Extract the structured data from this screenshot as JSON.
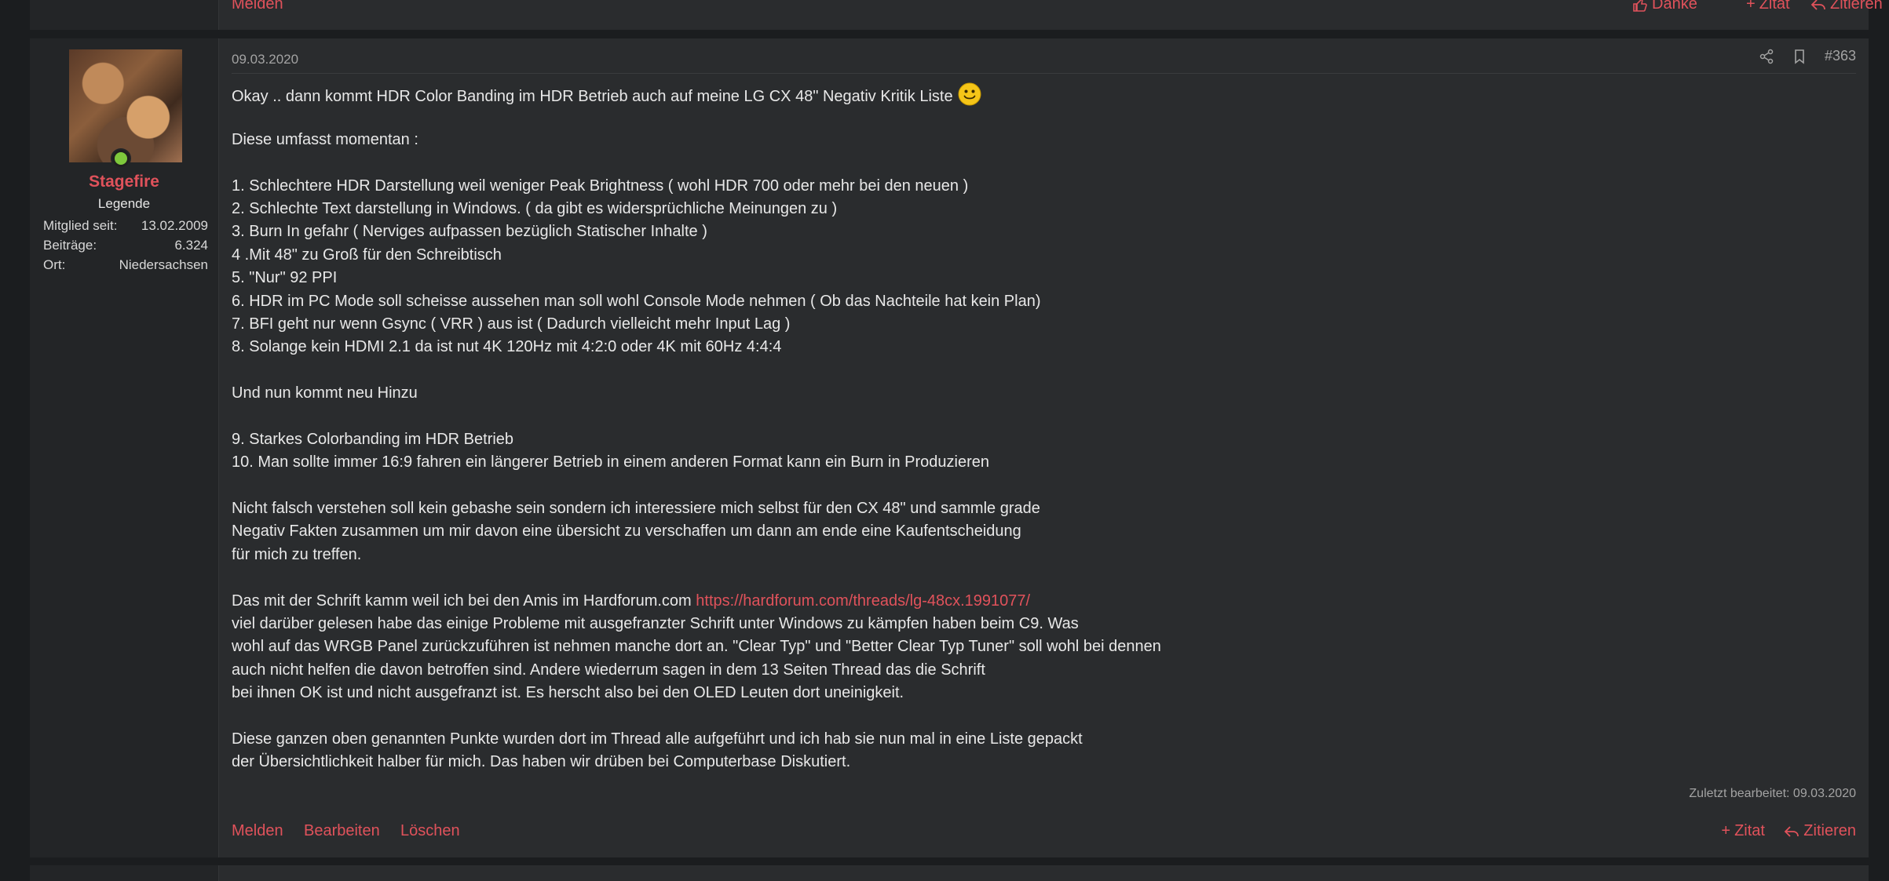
{
  "prev_post": {
    "actions": {
      "report": "Melden",
      "thanks": "Danke",
      "quote": "Zitat",
      "reply": "Zitieren"
    }
  },
  "user": {
    "name": "Stagefire",
    "rank": "Legende",
    "member_since_label": "Mitglied seit:",
    "member_since": "13.02.2009",
    "posts_label": "Beiträge:",
    "posts": "6.324",
    "location_label": "Ort:",
    "location": "Niedersachsen"
  },
  "post": {
    "date": "09.03.2020",
    "number": "#363",
    "first_line": "Okay .. dann kommt HDR Color Banding im HDR Betrieb auch auf meine LG CX 48\" Negativ Kritik Liste",
    "lines_a": [
      "",
      "Diese umfasst momentan :",
      "",
      "1. Schlechtere HDR Darstellung weil weniger Peak Brightness ( wohl HDR 700 oder mehr bei den neuen )",
      "2. Schlechte Text darstellung in Windows. ( da gibt es widersprüchliche Meinungen zu )",
      "3. Burn In gefahr ( Nerviges aufpassen bezüglich Statischer Inhalte )",
      "4 .Mit 48\" zu Groß für den Schreibtisch",
      "5. \"Nur\" 92 PPI",
      "6. HDR im PC Mode soll scheisse aussehen man soll wohl Console Mode nehmen ( Ob das Nachteile hat kein Plan)",
      "7. BFI geht nur wenn Gsync ( VRR ) aus ist ( Dadurch vielleicht mehr Input Lag )",
      "8. Solange kein HDMI 2.1 da ist nut 4K 120Hz mit 4:2:0 oder 4K mit 60Hz 4:4:4",
      "",
      "Und nun kommt neu Hinzu",
      "",
      "9. Starkes Colorbanding im HDR Betrieb",
      "10. Man sollte immer 16:9 fahren ein längerer Betrieb in einem anderen Format kann ein Burn in Produzieren",
      "",
      "Nicht falsch verstehen soll kein gebashe sein sondern ich interessiere mich selbst für den CX 48\" und sammle grade",
      "Negativ Fakten zusammen um mir davon eine übersicht zu verschaffen um dann am ende eine Kaufentscheidung",
      "für mich zu treffen.",
      ""
    ],
    "link_line_prefix": "Das mit der Schrift kamm weil ich bei den Amis im Hardforum.com ",
    "link_url": "https://hardforum.com/threads/lg-48cx.1991077/",
    "lines_b": [
      "viel darüber gelesen habe das einige Probleme mit ausgefranzter Schrift unter Windows zu kämpfen haben beim C9. Was",
      "wohl auf das WRGB Panel zurückzuführen ist nehmen manche dort an. \"Clear Typ\" und \"Better Clear Typ Tuner\" soll wohl bei dennen",
      "auch nicht helfen die davon betroffen sind. Andere wiederrum sagen in dem 13 Seiten Thread das die Schrift",
      "bei ihnen OK ist und nicht ausgefranzt ist. Es herscht also bei den OLED Leuten dort uneinigkeit.",
      "",
      "Diese ganzen oben genannten Punkte wurden dort im Thread alle aufgeführt und ich hab sie nun mal in eine Liste gepackt",
      "der Übersichtlichkeit halber für mich. Das haben wir drüben bei Computerbase Diskutiert."
    ],
    "edited": "Zuletzt bearbeitet: 09.03.2020",
    "actions": {
      "report": "Melden",
      "edit": "Bearbeiten",
      "delete": "Löschen",
      "quote": "Zitat",
      "reply": "Zitieren"
    }
  },
  "colors": {
    "accent": "#e0525b",
    "online": "#7ec83c",
    "panel": "#2a2c2e",
    "sidebar": "#232527"
  }
}
